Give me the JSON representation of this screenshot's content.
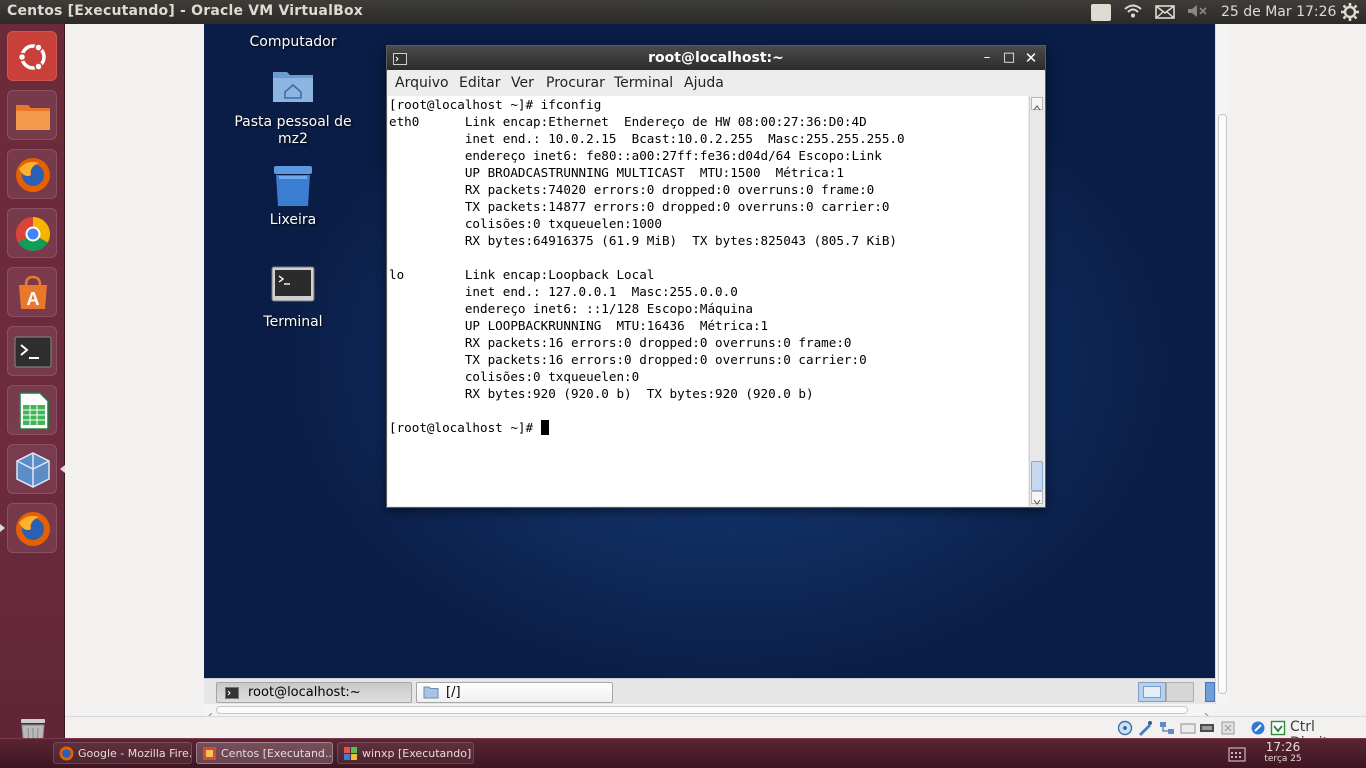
{
  "top_panel": {
    "window_title": "Centos  [Executando] - Oracle VM VirtualBox",
    "keyboard_layout": "Pt",
    "datetime": "25 de Mar  17:26"
  },
  "launcher": {
    "items": [
      "ubuntu-dash",
      "files",
      "firefox",
      "chrome",
      "software-center",
      "terminal",
      "libreoffice-calc",
      "virtualbox",
      "firefox-2",
      "trash"
    ]
  },
  "guest_desktop": {
    "icons": [
      {
        "label": "Computador"
      },
      {
        "label": "Pasta pessoal de\nmz2"
      },
      {
        "label": "Lixeira"
      },
      {
        "label": "Terminal"
      }
    ]
  },
  "terminal": {
    "title": "root@localhost:~",
    "menu": [
      "Arquivo",
      "Editar",
      "Ver",
      "Procurar",
      "Terminal",
      "Ajuda"
    ],
    "output": "[root@localhost ~]# ifconfig\neth0      Link encap:Ethernet  Endereço de HW 08:00:27:36:D0:4D\n          inet end.: 10.0.2.15  Bcast:10.0.2.255  Masc:255.255.255.0\n          endereço inet6: fe80::a00:27ff:fe36:d04d/64 Escopo:Link\n          UP BROADCASTRUNNING MULTICAST  MTU:1500  Métrica:1\n          RX packets:74020 errors:0 dropped:0 overruns:0 frame:0\n          TX packets:14877 errors:0 dropped:0 overruns:0 carrier:0\n          colisões:0 txqueuelen:1000\n          RX bytes:64916375 (61.9 MiB)  TX bytes:825043 (805.7 KiB)\n\nlo        Link encap:Loopback Local\n          inet end.: 127.0.0.1  Masc:255.0.0.0\n          endereço inet6: ::1/128 Escopo:Máquina\n          UP LOOPBACKRUNNING  MTU:16436  Métrica:1\n          RX packets:16 errors:0 dropped:0 overruns:0 frame:0\n          TX packets:16 errors:0 dropped:0 overruns:0 carrier:0\n          colisões:0 txqueuelen:0\n          RX bytes:920 (920.0 b)  TX bytes:920 (920.0 b)\n\n[root@localhost ~]# "
  },
  "guest_taskbar": {
    "tasks": [
      {
        "label": "root@localhost:~",
        "active": true
      },
      {
        "label": "[/]",
        "active": false
      }
    ]
  },
  "vbox_status": {
    "host_key": "Ctrl Direito"
  },
  "host_taskbar": {
    "tasks": [
      {
        "label": "Google - Mozilla Fire..."
      },
      {
        "label": "Centos  [Executand..."
      },
      {
        "label": "winxp [Executando] ..."
      }
    ],
    "clock_time": "17:26",
    "clock_date": "terça 25 março"
  }
}
